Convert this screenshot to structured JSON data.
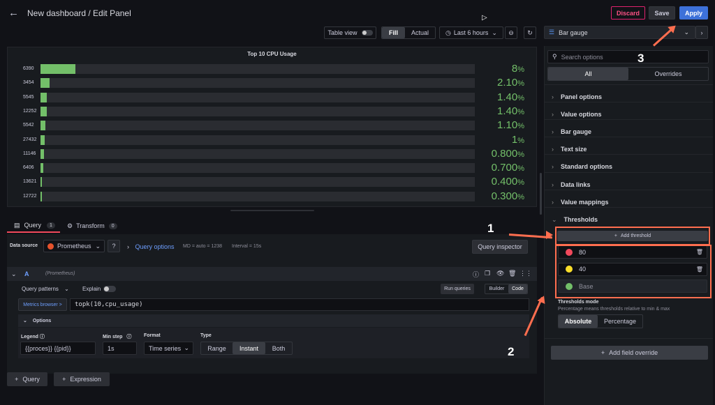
{
  "header": {
    "title": "New dashboard / Edit Panel",
    "discard_label": "Discard",
    "save_label": "Save",
    "apply_label": "Apply"
  },
  "toolbar": {
    "table_view_label": "Table view",
    "fill_label": "Fill",
    "actual_label": "Actual",
    "time_range": "Last 6 hours"
  },
  "chart_data": {
    "type": "bar",
    "title": "Top 10 CPU Usage",
    "categories": [
      "6390",
      "3454",
      "5545",
      "12252",
      "5542",
      "27432",
      "11146",
      "6406",
      "13621",
      "12722"
    ],
    "values": [
      8,
      2.1,
      1.4,
      1.4,
      1.1,
      1,
      0.8,
      0.7,
      0.4,
      0.3
    ],
    "value_labels": [
      "8",
      "2.10",
      "1.40",
      "1.40",
      "1.10",
      "1",
      "0.800",
      "0.700",
      "0.400",
      "0.300"
    ],
    "unit": "%",
    "ylim": [
      0,
      100
    ],
    "color": "#73bf69"
  },
  "query_tabs": {
    "query_label": "Query",
    "query_count": "1",
    "transform_label": "Transform",
    "transform_count": "0"
  },
  "datasource": {
    "label": "Data source",
    "name": "Prometheus",
    "query_options_label": "Query options",
    "md_info": "MD = auto = 1238",
    "interval_info": "Interval = 15s",
    "query_inspector_label": "Query inspector"
  },
  "query_row": {
    "ref": "A",
    "source": "(Prometheus)",
    "patterns_label": "Query patterns",
    "explain_label": "Explain",
    "run_queries_label": "Run queries",
    "builder_label": "Builder",
    "code_label": "Code",
    "metrics_browser_label": "Metrics browser >",
    "expression": "topk(10,cpu_usage)",
    "options_label": "Options",
    "legend_label": "Legend",
    "legend_value": "{{proces}} {{pid}}",
    "min_step_label": "Min step",
    "min_step_value": "1s",
    "format_label": "Format",
    "format_value": "Time series",
    "type_label": "Type",
    "type_range": "Range",
    "type_instant": "Instant",
    "type_both": "Both",
    "add_query_label": "Query",
    "add_expression_label": "Expression"
  },
  "right_panel": {
    "viz_name": "Bar gauge",
    "search_placeholder": "Search options",
    "tab_all": "All",
    "tab_overrides": "Overrides",
    "sections": [
      "Panel options",
      "Value options",
      "Bar gauge",
      "Text size",
      "Standard options",
      "Data links",
      "Value mappings",
      "Thresholds"
    ],
    "add_threshold_label": "Add threshold",
    "thresholds": [
      {
        "value": "80",
        "color": "#f2495c"
      },
      {
        "value": "40",
        "color": "#fade2a"
      },
      {
        "value": "Base",
        "color": "#73bf69"
      }
    ],
    "thresholds_mode_label": "Thresholds mode",
    "thresholds_mode_desc": "Percentage means thresholds relative to min & max",
    "mode_absolute": "Absolute",
    "mode_percentage": "Percentage",
    "add_field_override_label": "Add field override"
  },
  "annotations": {
    "one": "1",
    "two": "2",
    "three": "3"
  }
}
